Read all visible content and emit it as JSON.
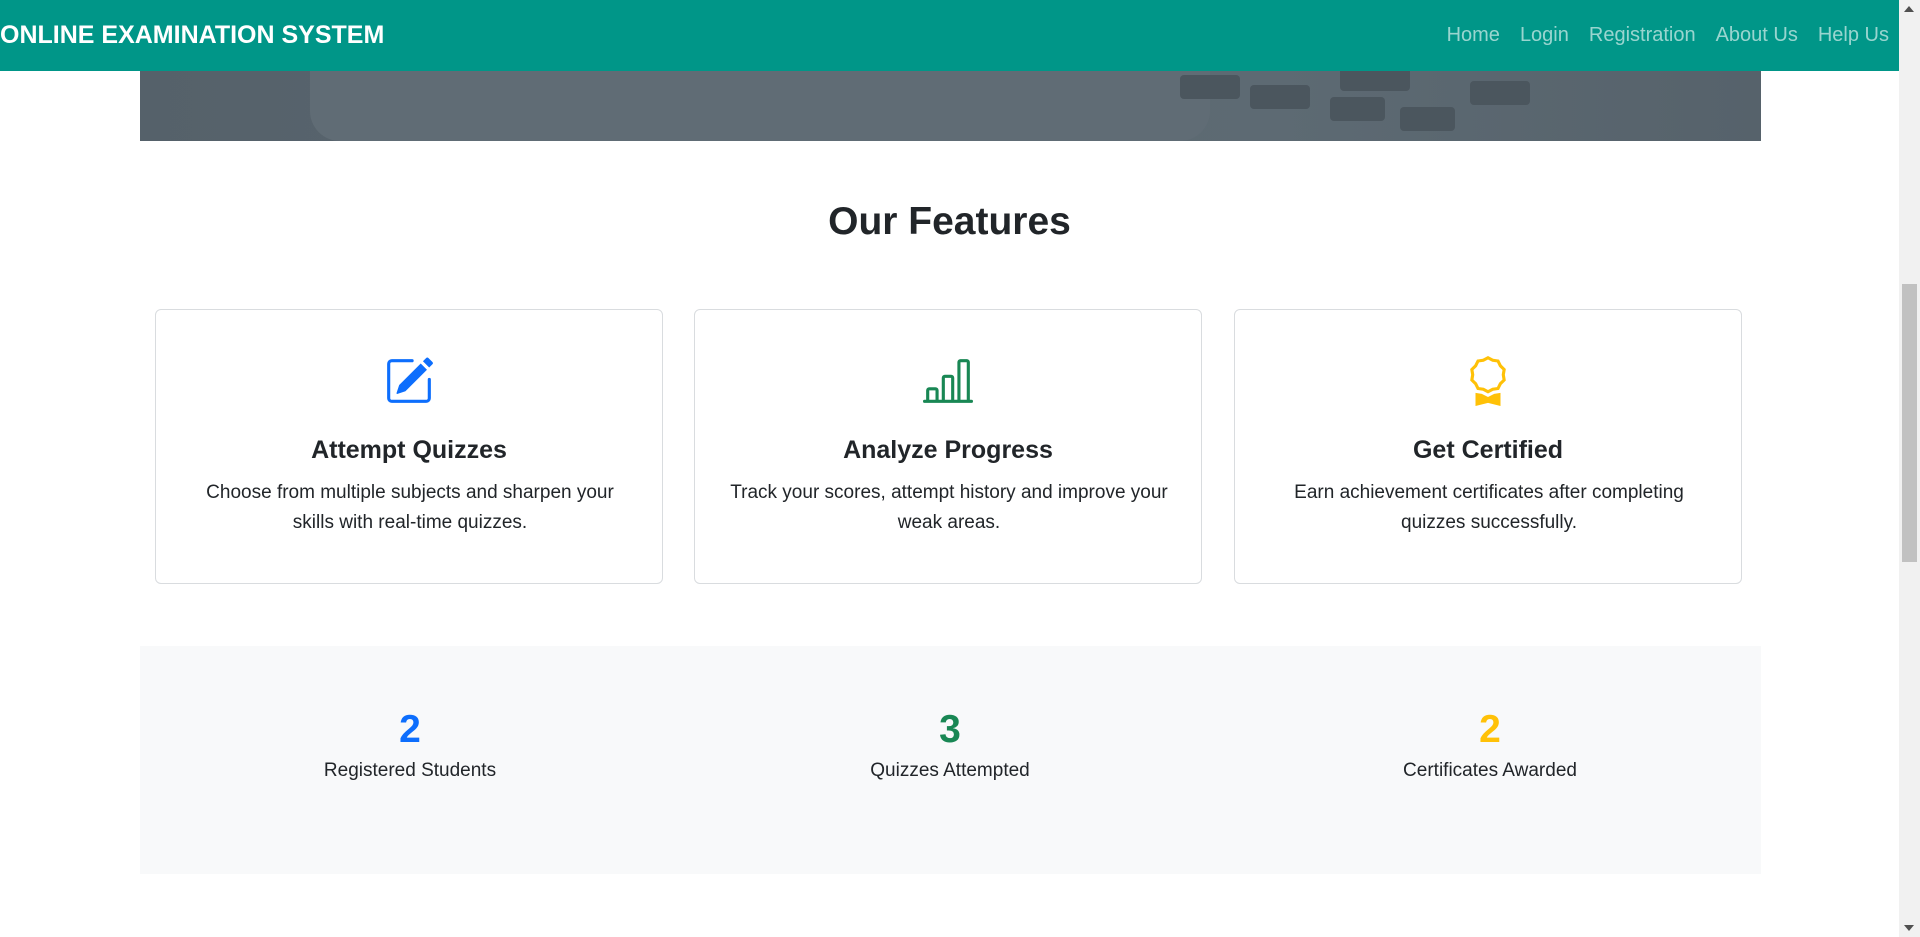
{
  "navbar": {
    "brand": "ONLINE EXAMINATION SYSTEM",
    "links": [
      "Home",
      "Login",
      "Registration",
      "About Us",
      "Help Us"
    ]
  },
  "features": {
    "title": "Our Features",
    "cards": [
      {
        "icon": "pencil-square-icon",
        "title": "Attempt Quizzes",
        "description": "Choose from multiple subjects and sharpen your skills with real-time quizzes.",
        "color": "#0d6efd"
      },
      {
        "icon": "bar-chart-icon",
        "title": "Analyze Progress",
        "description": "Track your scores, attempt history and improve your weak areas.",
        "color": "#198754"
      },
      {
        "icon": "award-icon",
        "title": "Get Certified",
        "description": "Earn achievement certificates after completing quizzes successfully.",
        "color": "#ffc107"
      }
    ]
  },
  "stats": [
    {
      "value": "2",
      "label": "Registered Students",
      "color": "#0d6efd"
    },
    {
      "value": "3",
      "label": "Quizzes Attempted",
      "color": "#198754"
    },
    {
      "value": "2",
      "label": "Certificates Awarded",
      "color": "#ffc107"
    }
  ],
  "colors": {
    "navbar_bg": "#009688",
    "stats_bg": "#f8f9fa"
  }
}
